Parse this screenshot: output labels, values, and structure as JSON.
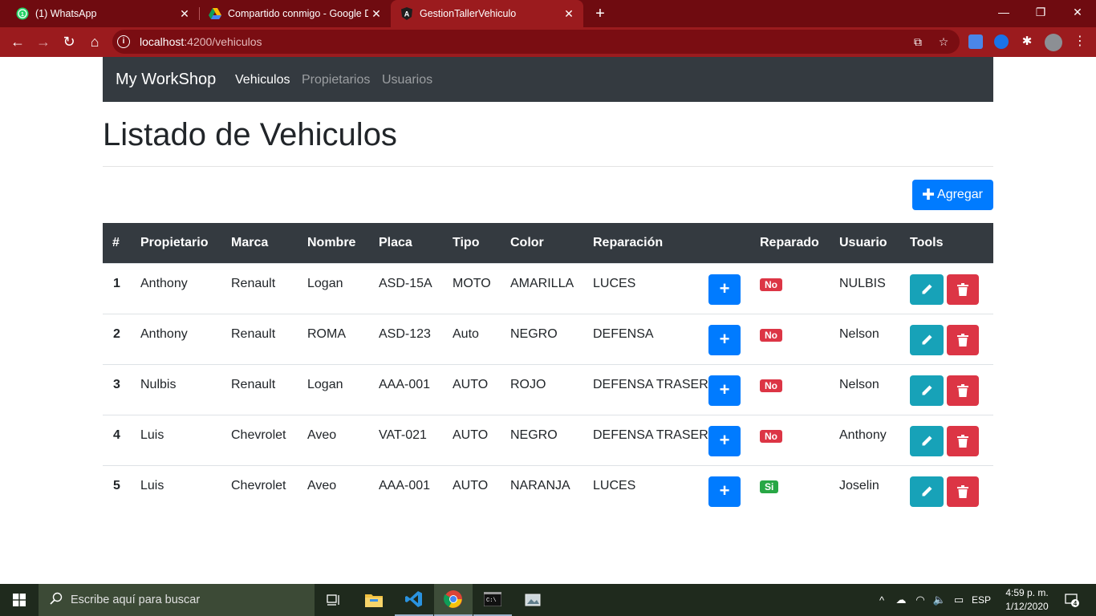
{
  "browser": {
    "tabs": [
      {
        "title": "(1) WhatsApp",
        "active": false
      },
      {
        "title": "Compartido conmigo - Google Drive",
        "active": false
      },
      {
        "title": "GestionTallerVehiculo",
        "active": true
      }
    ],
    "url_host": "localhost",
    "url_path": ":4200/vehiculos"
  },
  "app": {
    "brand": "My WorkShop",
    "nav": [
      {
        "label": "Vehiculos",
        "active": true
      },
      {
        "label": "Propietarios",
        "active": false
      },
      {
        "label": "Usuarios",
        "active": false
      }
    ]
  },
  "page": {
    "title": "Listado de Vehiculos",
    "add_label": "Agregar"
  },
  "table": {
    "headers": [
      "#",
      "Propietario",
      "Marca",
      "Nombre",
      "Placa",
      "Tipo",
      "Color",
      "Reparación",
      "Reparado",
      "Usuario",
      "Tools"
    ],
    "rows": [
      {
        "id": "1",
        "propietario": "Anthony",
        "marca": "Renault",
        "nombre": "Logan",
        "placa": "ASD-15A",
        "tipo": "MOTO",
        "color": "AMARILLA",
        "reparacion": "LUCES",
        "reparado": "No",
        "usuario": "NULBIS"
      },
      {
        "id": "2",
        "propietario": "Anthony",
        "marca": "Renault",
        "nombre": "ROMA",
        "placa": "ASD-123",
        "tipo": "Auto",
        "color": "NEGRO",
        "reparacion": "DEFENSA",
        "reparado": "No",
        "usuario": "Nelson"
      },
      {
        "id": "3",
        "propietario": "Nulbis",
        "marca": "Renault",
        "nombre": "Logan",
        "placa": "AAA-001",
        "tipo": "AUTO",
        "color": "ROJO",
        "reparacion": "DEFENSA TRASERA",
        "reparado": "No",
        "usuario": "Nelson"
      },
      {
        "id": "4",
        "propietario": "Luis",
        "marca": "Chevrolet",
        "nombre": "Aveo",
        "placa": "VAT-021",
        "tipo": "AUTO",
        "color": "NEGRO",
        "reparacion": "DEFENSA TRASERA",
        "reparado": "No",
        "usuario": "Anthony"
      },
      {
        "id": "5",
        "propietario": "Luis",
        "marca": "Chevrolet",
        "nombre": "Aveo",
        "placa": "AAA-001",
        "tipo": "AUTO",
        "color": "NARANJA",
        "reparacion": "LUCES",
        "reparado": "Si",
        "usuario": "Joselin"
      }
    ]
  },
  "taskbar": {
    "search_placeholder": "Escribe aquí para buscar",
    "language": "ESP",
    "time": "4:59 p. m.",
    "date": "1/12/2020",
    "notifications": "4"
  },
  "colors": {
    "primary": "#007bff",
    "info": "#17a2b8",
    "danger": "#dc3545",
    "success": "#28a745",
    "navbar_dark": "#343a40",
    "chrome_frame": "#6f0b10"
  }
}
